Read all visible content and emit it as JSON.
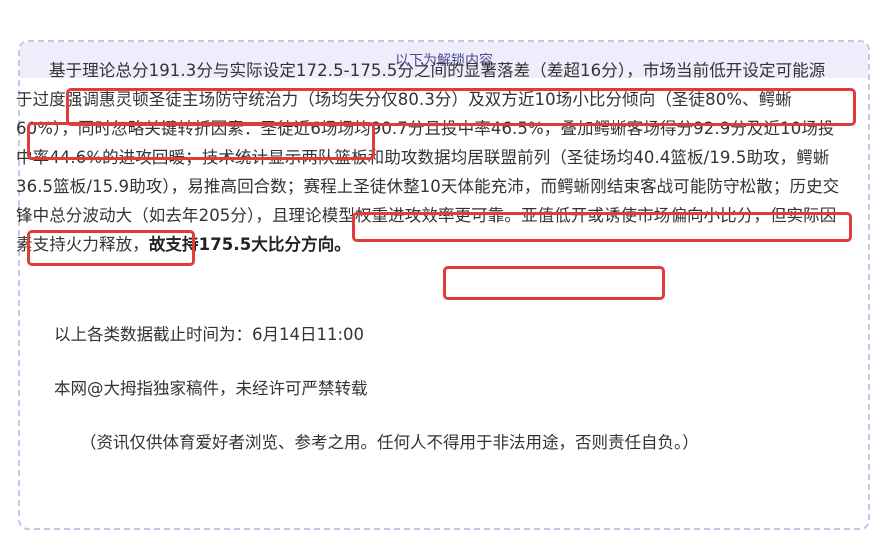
{
  "header": {
    "title": "以下为解锁内容"
  },
  "analysis": {
    "p1": "基于理论总分191.3分与实际设定172.5-175.5分之间的显著落差（差超16分），市场当前低开设定可能源于过度强调惠灵顿圣徒主场防守统治力（场均失分仅80.3分）及双方近10场小比分倾向（圣徒80%、鳄蜥60%），同时忽略关键转折因素：圣徒近6场场均90.7分且投中率46.5%，叠加鳄蜥客场得分92.9分及近10场投中率44.6%的进攻回暖；技术统计显示两队篮板和助攻数据均居联盟前列（圣徒场均40.4篮板/19.5助攻，鳄蜥36.5篮板/15.9助攻），易推高回合数；赛程上圣徒休整10天体能充沛，而鳄蜥刚结束客战可能防守松散；历史交锋中总分波动大（如去年205分），且理论模型权重进攻效率更可靠。亚值低开或诱使市场偏向小比分，但实际因素支持火力释放，",
    "conclusion": "故支持175.5大比分方向。"
  },
  "meta": {
    "cutoff": "以上各类数据截止时间为：6月14日11:00",
    "copyright": "本网@大拇指独家稿件，未经许可严禁转载",
    "disclaimer": "（资讯仅供体育爱好者浏览、参考之用。任何人不得用于非法用途，否则责任自负。）"
  },
  "colors": {
    "highlight": "#e23b3b",
    "header_bg": "#efedfb",
    "border": "#c9c5e8"
  }
}
